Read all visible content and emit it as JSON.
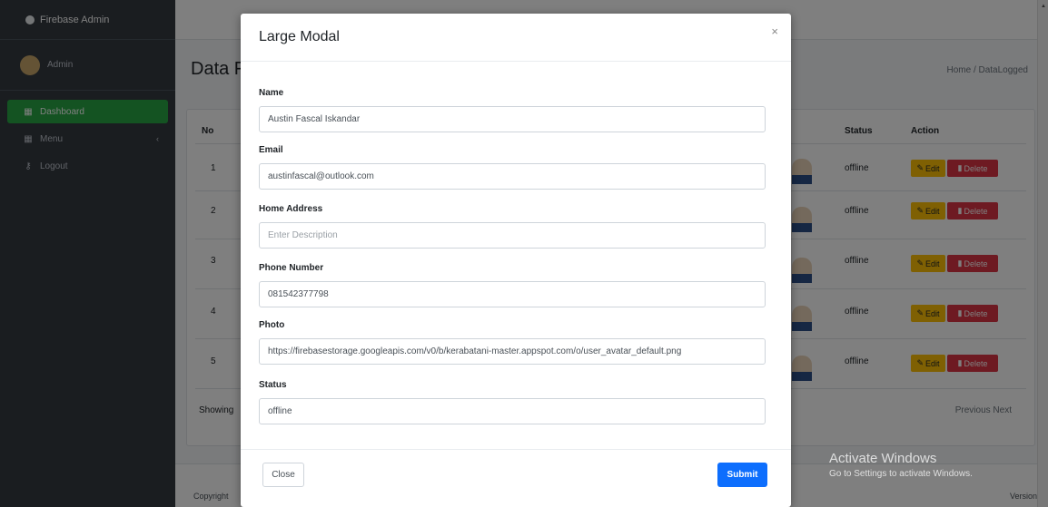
{
  "colors": {
    "sidebar_bg": "#343a40",
    "active_nav": "#28a745",
    "edit_button": "#ffc107",
    "delete_button": "#dc3545",
    "submit_button": "#0d6efd"
  },
  "background": {
    "brand": "Firebase Admin",
    "user_name": "Admin",
    "sidebar": {
      "items": [
        {
          "label": "Dashboard",
          "icon": "dashboard-icon"
        },
        {
          "label": "Menu",
          "icon": "menu-icon"
        },
        {
          "label": "Logout",
          "icon": "key-icon"
        }
      ]
    },
    "page_title": "Data F",
    "breadcrumb": "Home / DataLogged",
    "table": {
      "columns": [
        "No",
        "Status",
        "Action"
      ],
      "rows": [
        {
          "no": "1",
          "status": "offline"
        },
        {
          "no": "2",
          "status": "offline"
        },
        {
          "no": "3",
          "status": "offline"
        },
        {
          "no": "4",
          "status": "offline"
        },
        {
          "no": "5",
          "status": "offline"
        }
      ],
      "edit_label": "Edit",
      "delete_label": "Delete",
      "showing": "Showing",
      "pager": "Previous  Next"
    },
    "footer_left": "Copyright",
    "footer_right": "Version"
  },
  "modal": {
    "title": "Large Modal",
    "close_symbol": "×",
    "fields": {
      "name": {
        "label": "Name",
        "value": "Austin Fascal Iskandar",
        "placeholder": ""
      },
      "email": {
        "label": "Email",
        "value": "austinfascal@outlook.com",
        "placeholder": ""
      },
      "address": {
        "label": "Home Address",
        "value": "",
        "placeholder": "Enter Description"
      },
      "phone": {
        "label": "Phone Number",
        "value": "081542377798",
        "placeholder": ""
      },
      "photo": {
        "label": "Photo",
        "value": "https://firebasestorage.googleapis.com/v0/b/kerabatani-master.appspot.com/o/user_avatar_default.png",
        "placeholder": ""
      },
      "status": {
        "label": "Status",
        "value": "offline",
        "placeholder": ""
      }
    },
    "close_button": "Close",
    "submit_button": "Submit"
  },
  "watermark": {
    "title": "Activate Windows",
    "subtitle": "Go to Settings to activate Windows."
  }
}
